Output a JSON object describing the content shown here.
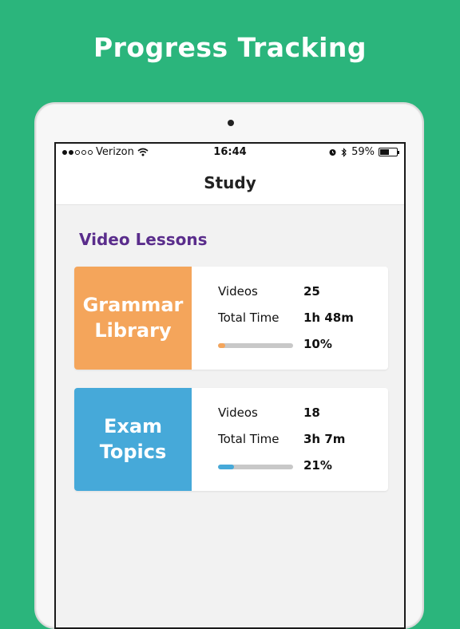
{
  "headline": "Progress Tracking",
  "colors": {
    "background": "#2bb57c",
    "section_title": "#5a2d8c",
    "grammar_accent": "#f4a55b",
    "exam_accent": "#46a9d9"
  },
  "status_bar": {
    "carrier": "Verizon",
    "signal_icon": "signal-dots-icon",
    "wifi_icon": "wifi-icon",
    "time": "16:44",
    "alarm_icon": "alarm-icon",
    "bluetooth_icon": "bluetooth-icon",
    "battery_percent": "59%",
    "battery_level": 0.59
  },
  "nav": {
    "title": "Study"
  },
  "section": {
    "title": "Video Lessons"
  },
  "lessons": [
    {
      "thumb_label": "Grammar Library",
      "color": "#f4a55b",
      "videos_label": "Videos",
      "videos_value": "25",
      "time_label": "Total Time",
      "time_value": "1h 48m",
      "progress_text": "10%",
      "progress": 0.1
    },
    {
      "thumb_label": "Exam Topics",
      "color": "#46a9d9",
      "videos_label": "Videos",
      "videos_value": "18",
      "time_label": "Total Time",
      "time_value": "3h 7m",
      "progress_text": "21%",
      "progress": 0.21
    }
  ]
}
